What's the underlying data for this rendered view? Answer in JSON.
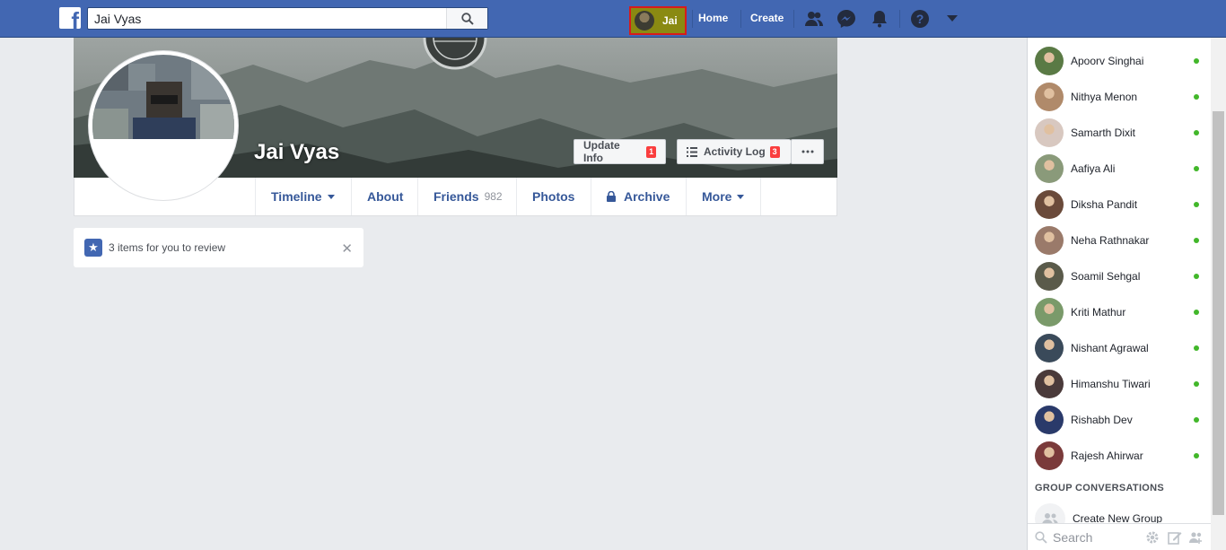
{
  "topbar": {
    "search_value": "Jai Vyas",
    "profile_name": "Jai",
    "home_label": "Home",
    "create_label": "Create"
  },
  "profile": {
    "name": "Jai Vyas",
    "update_info_label": "Update Info",
    "update_info_count": "1",
    "activity_log_label": "Activity Log",
    "activity_log_count": "3"
  },
  "tabs": {
    "timeline": "Timeline",
    "about": "About",
    "friends": "Friends",
    "friends_count": "982",
    "photos": "Photos",
    "archive": "Archive",
    "more": "More"
  },
  "review": {
    "text": "3 items for you to review"
  },
  "chat": {
    "contacts": [
      {
        "name": "Apoorv Singhai",
        "color": "#5a7a45"
      },
      {
        "name": "Nithya Menon",
        "color": "#b08a6a"
      },
      {
        "name": "Samarth Dixit",
        "color": "#d8c8c0"
      },
      {
        "name": "Aafiya Ali",
        "color": "#8a9a7a"
      },
      {
        "name": "Diksha Pandit",
        "color": "#6a4a3a"
      },
      {
        "name": "Neha Rathnakar",
        "color": "#9a7a6a"
      },
      {
        "name": "Soamil Sehgal",
        "color": "#5a5a4a"
      },
      {
        "name": "Kriti Mathur",
        "color": "#7a9a6a"
      },
      {
        "name": "Nishant Agrawal",
        "color": "#3a4a5a"
      },
      {
        "name": "Himanshu Tiwari",
        "color": "#4a3a3a"
      },
      {
        "name": "Rishabh Dev",
        "color": "#2a3a6a"
      },
      {
        "name": "Rajesh Ahirwar",
        "color": "#7a3a3a"
      }
    ],
    "group_title": "GROUP CONVERSATIONS",
    "create_group_label": "Create New Group",
    "search_placeholder": "Search"
  },
  "colors": {
    "brand": "#4267b2",
    "online": "#42b72a",
    "badge": "#fa3e3e"
  }
}
